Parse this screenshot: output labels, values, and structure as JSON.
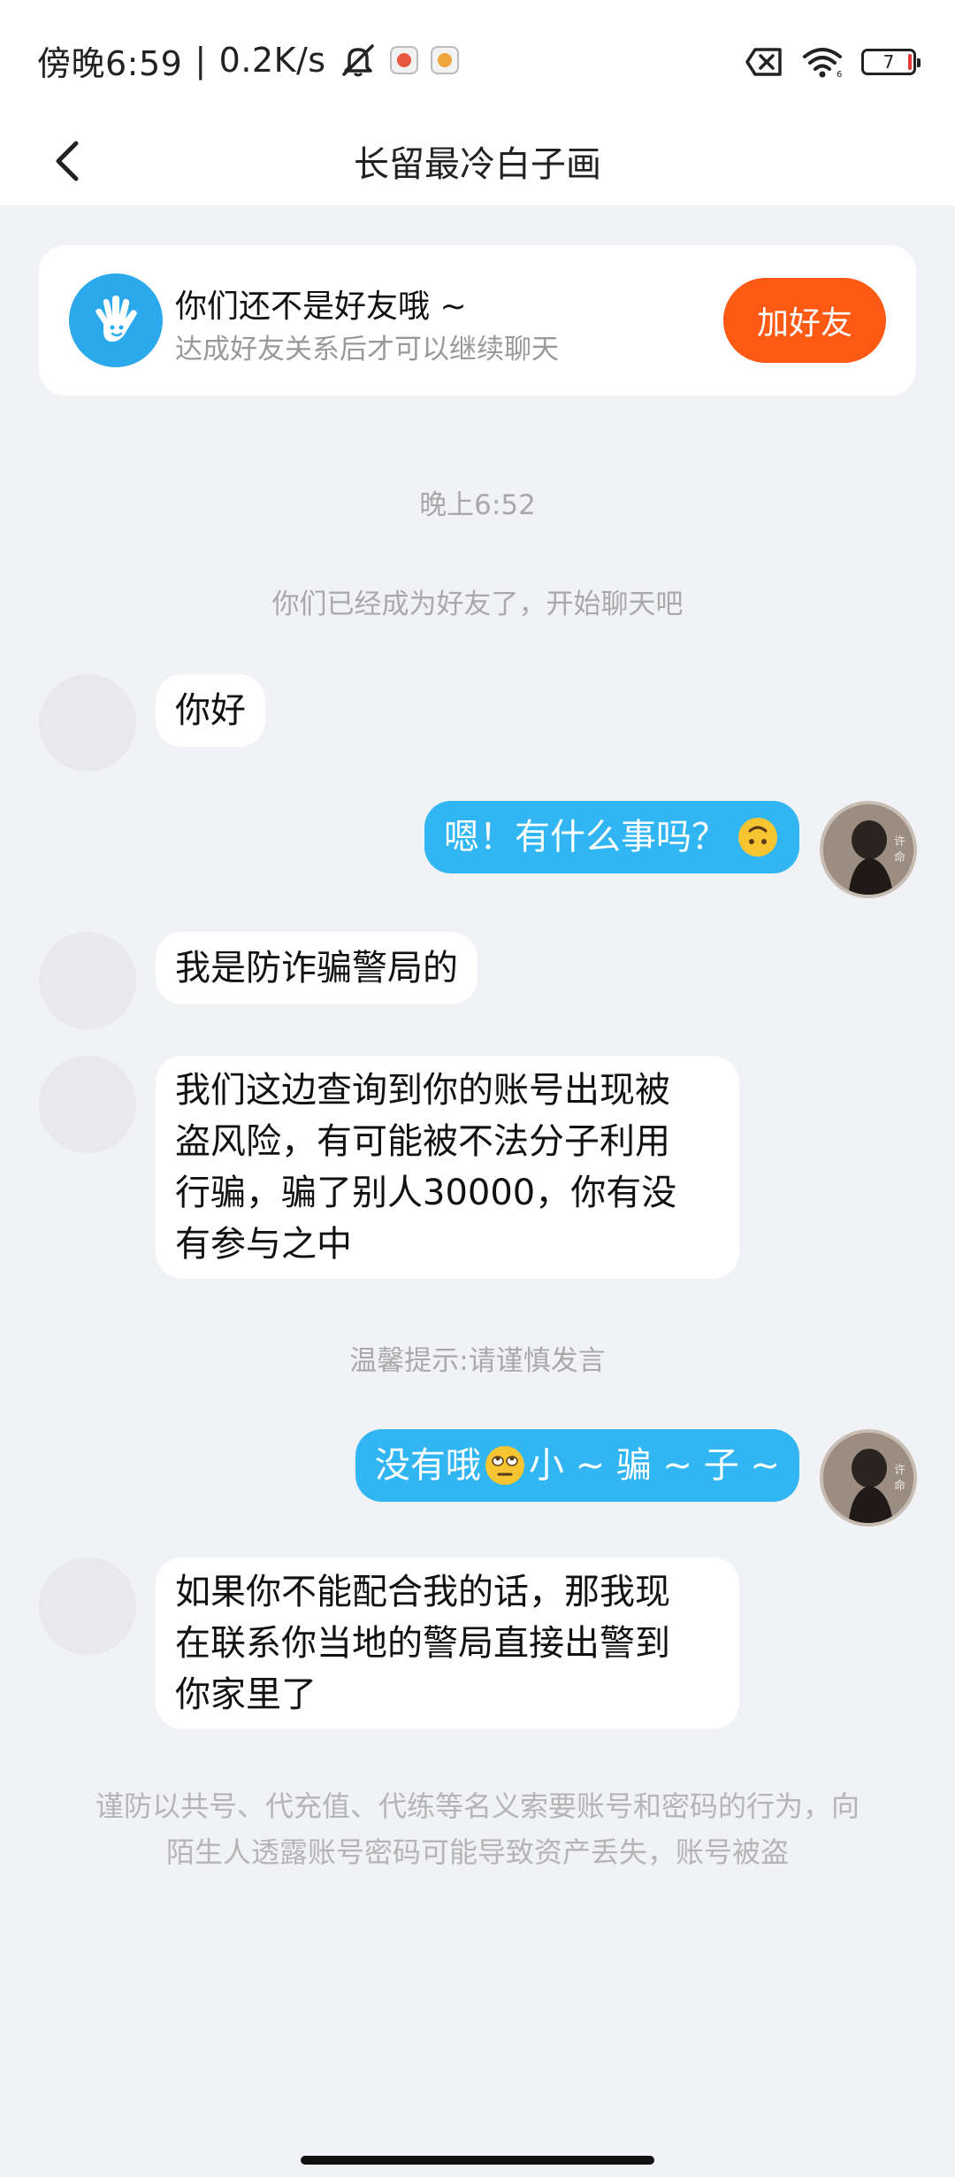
{
  "status_bar": {
    "time": "傍晚6:59",
    "separator": "|",
    "speed": "0.2K/s",
    "battery": "7",
    "icons": [
      "mute-icon",
      "app-badge-icon",
      "app-badge-icon",
      "sim-x-icon",
      "wifi-icon",
      "battery-icon"
    ]
  },
  "header": {
    "title": "长留最冷白子画",
    "back_icon": "chevron-left-icon"
  },
  "friend_card": {
    "title": "你们还不是好友哦 ~",
    "subtitle": "达成好友关系后才可以继续聊天",
    "button": "加好友",
    "icon": "wave-hand-icon"
  },
  "chat": {
    "timestamp": "晚上6:52",
    "system_note": "你们已经成为好友了，开始聊天吧",
    "tip": "温馨提示:请谨慎发言",
    "messages": [
      {
        "side": "in",
        "text": "你好"
      },
      {
        "side": "out",
        "text": "嗯！有什么事吗？",
        "emoji": "upside-down-face-emoji"
      },
      {
        "side": "in",
        "text": "我是防诈骗警局的"
      },
      {
        "side": "in",
        "lines": [
          "我们这边查询到你的账号出现被",
          "盗风险，有可能被不法分子利用",
          "行骗，骗了别人30000，你有没",
          "有参与之中"
        ]
      },
      {
        "side": "out",
        "text_before": "没有哦",
        "emoji": "eye-roll-emoji",
        "text_after": "小 ~ 骗 ~ 子 ~"
      },
      {
        "side": "in",
        "lines": [
          "如果你不能配合我的话，那我现",
          "在联系你当地的警局直接出警到",
          "你家里了"
        ]
      }
    ],
    "warning": [
      "谨防以共号、代充值、代练等名义索要账号和密码的行为，向",
      "陌生人透露账号密码可能导致资产丢失，账号被盗"
    ]
  },
  "colors": {
    "accent_blue": "#31b6f3",
    "add_button": "#ff5a14",
    "background": "#f1f2f6"
  }
}
